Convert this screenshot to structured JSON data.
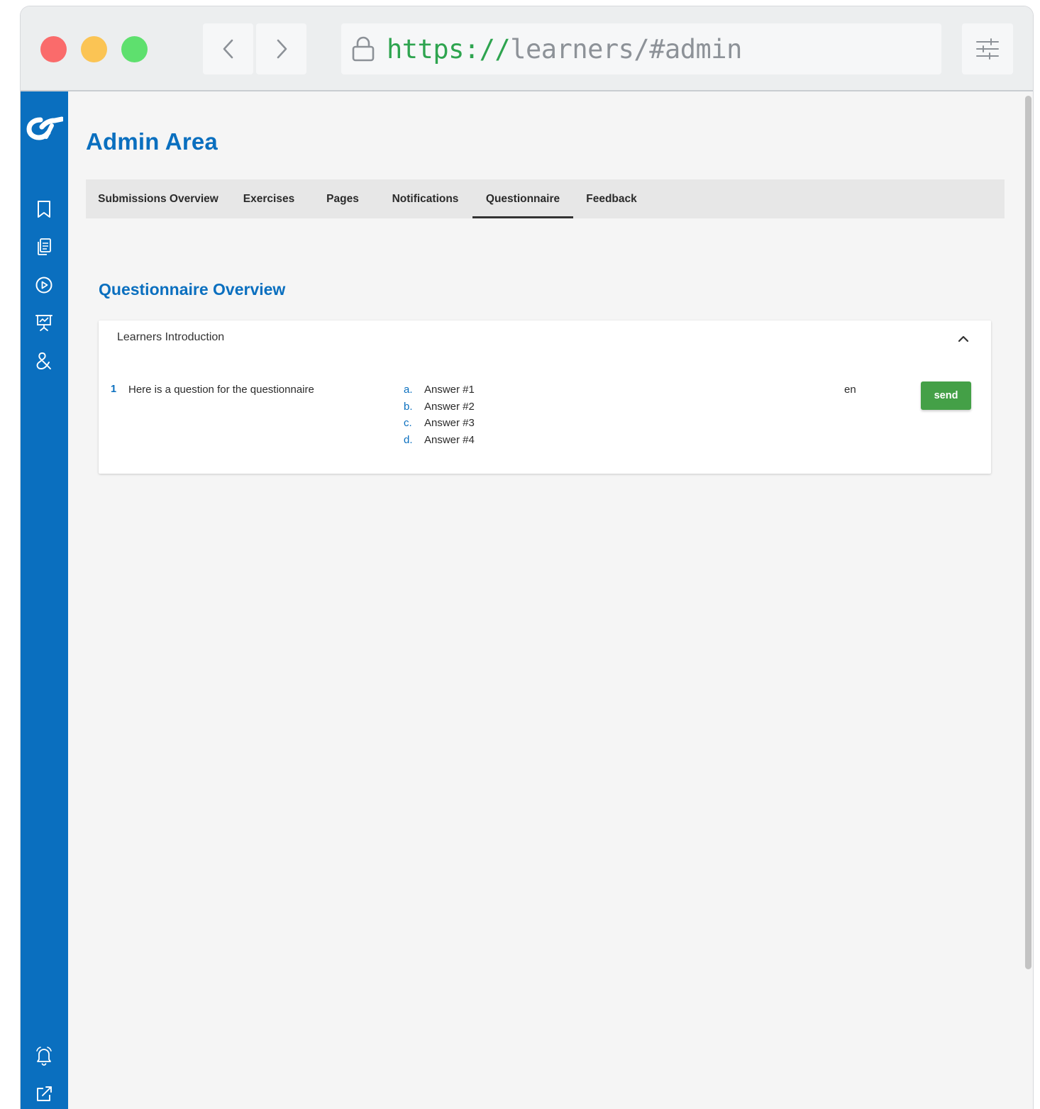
{
  "browser": {
    "url_scheme": "https://",
    "url_rest": "learners/#admin",
    "colors": {
      "close": "#fa6b6b",
      "minimize": "#fbc454",
      "maximize": "#5ee06e"
    }
  },
  "sidebar": {
    "color": "#0a6fbf",
    "icons": [
      "bookmark-icon",
      "clipboard-icon",
      "play-circle-icon",
      "presentation-icon",
      "ampersand-icon",
      "bell-icon",
      "external-link-icon"
    ]
  },
  "page": {
    "title": "Admin Area",
    "tabs": [
      {
        "label": "Submissions Overview",
        "active": false
      },
      {
        "label": "Exercises",
        "active": false
      },
      {
        "label": "Pages",
        "active": false
      },
      {
        "label": "Notifications",
        "active": false
      },
      {
        "label": "Questionnaire",
        "active": true
      },
      {
        "label": "Feedback",
        "active": false
      }
    ]
  },
  "questionnaire": {
    "section_title": "Questionnaire Overview",
    "card_title": "Learners Introduction",
    "question": {
      "number": "1",
      "text": "Here is a question for the questionnaire",
      "answers": [
        {
          "letter": "a.",
          "text": "Answer #1"
        },
        {
          "letter": "b.",
          "text": "Answer #2"
        },
        {
          "letter": "c.",
          "text": "Answer #3"
        },
        {
          "letter": "d.",
          "text": "Answer #4"
        }
      ],
      "language": "en",
      "send_label": "send"
    }
  }
}
